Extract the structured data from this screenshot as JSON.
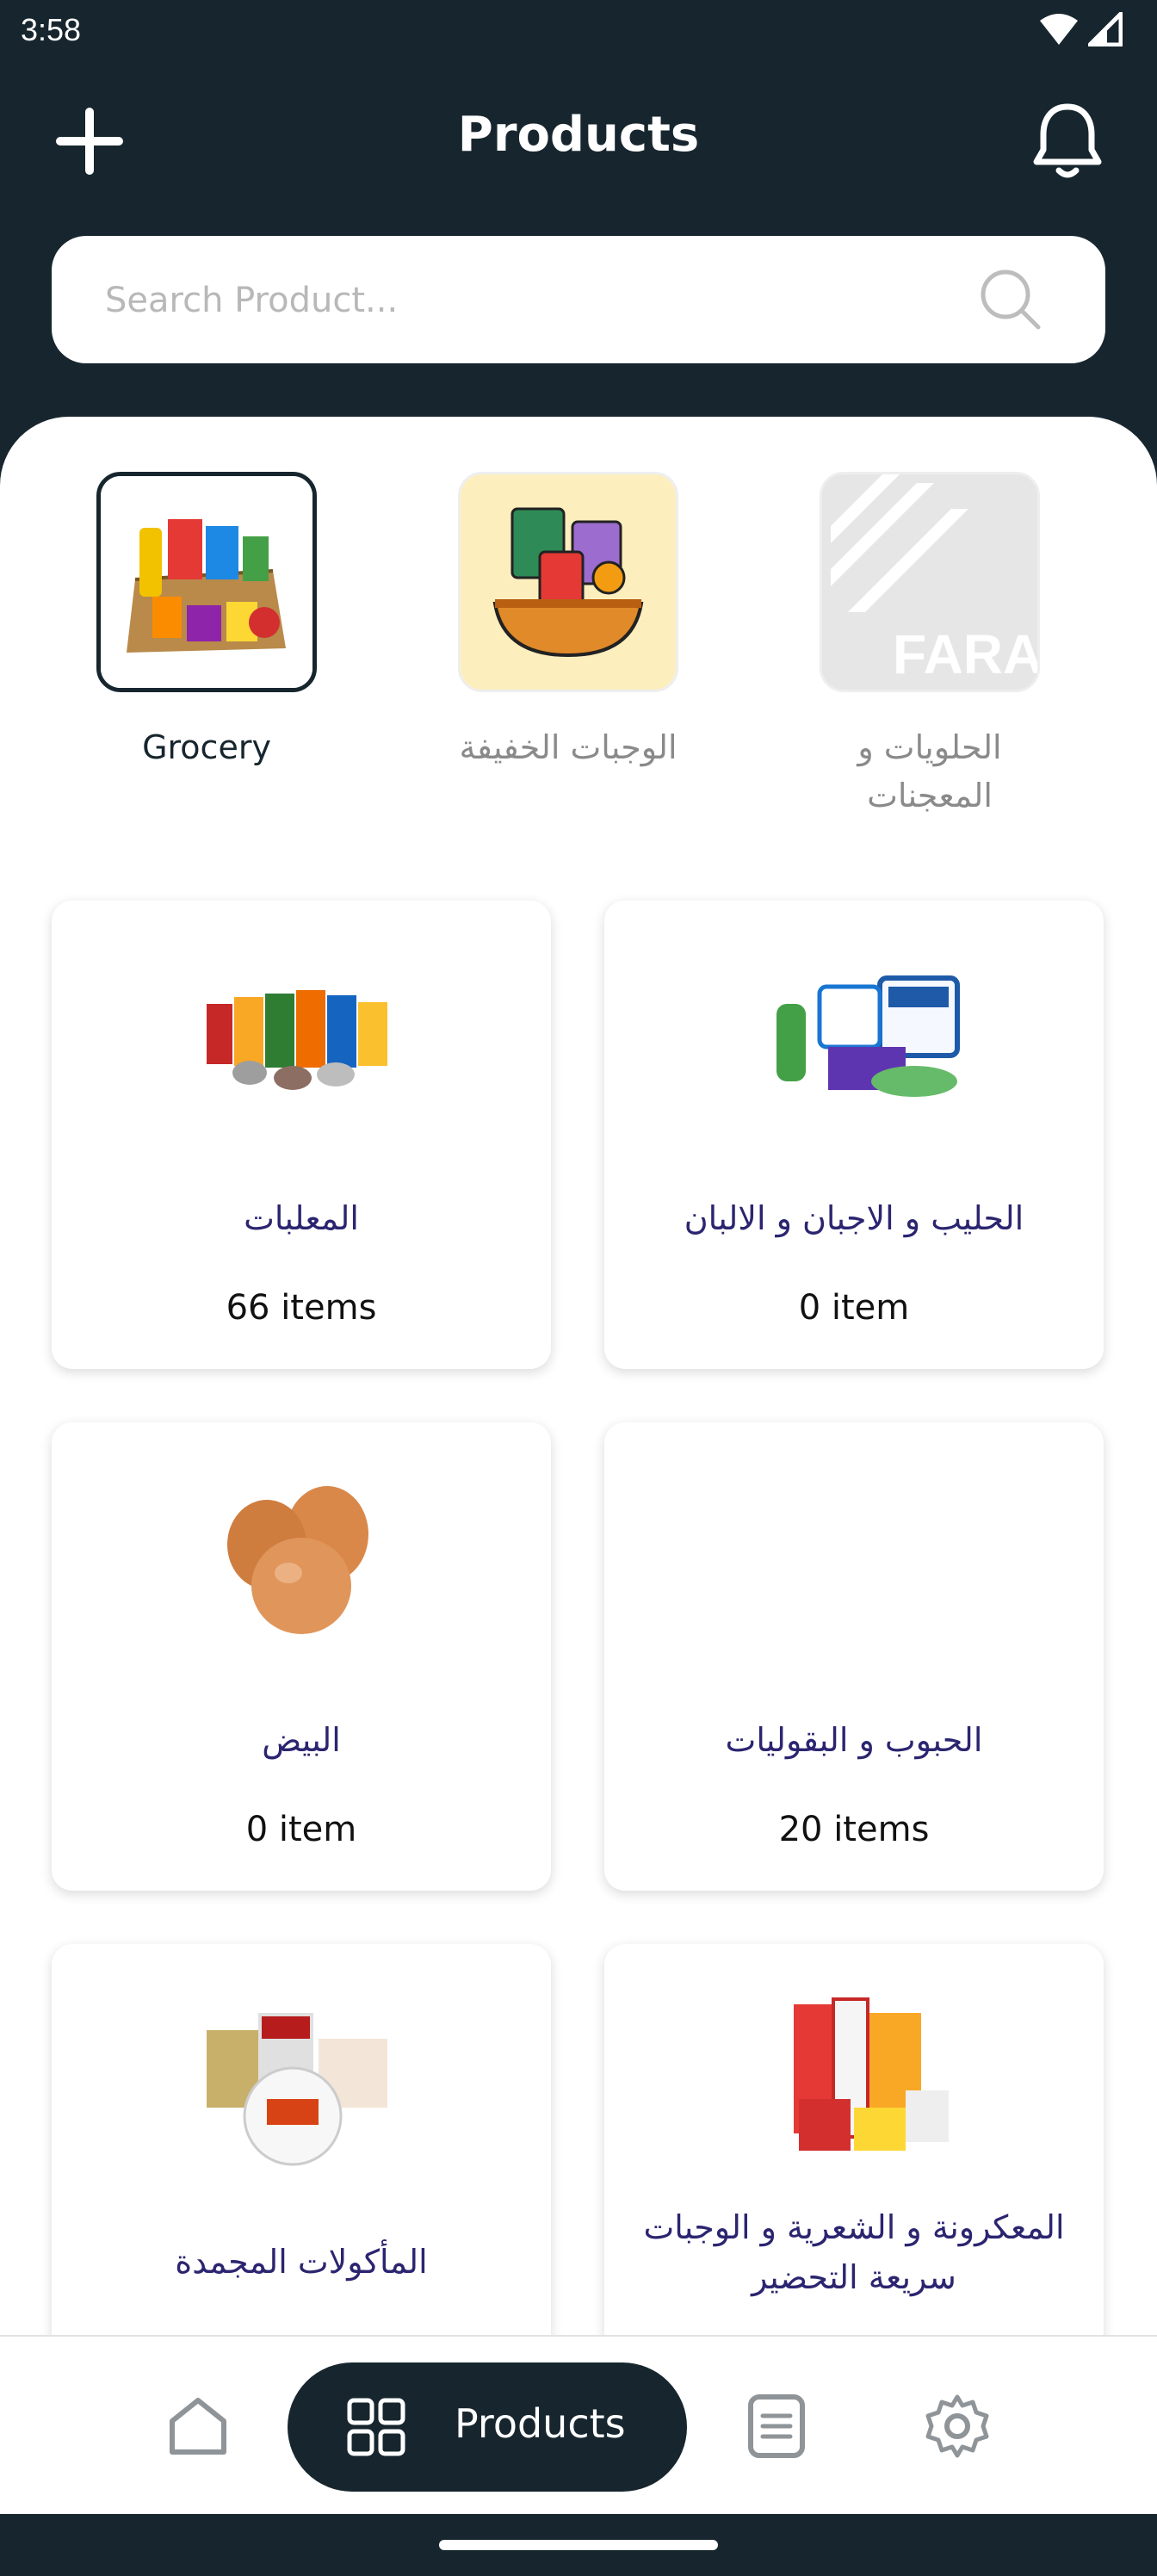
{
  "status": {
    "time": "3:58",
    "icons": [
      "wifi-icon",
      "signal-icon"
    ]
  },
  "header": {
    "title": "Products",
    "add_icon": "plus-icon",
    "notification_icon": "bell-icon"
  },
  "search": {
    "placeholder": "Search Product...",
    "value": "",
    "icon": "search-icon"
  },
  "categories": [
    {
      "label": "Grocery",
      "active": true
    },
    {
      "label": "الوجبات الخفيفة",
      "active": false
    },
    {
      "label": "الحلويات و المعجنات",
      "active": false,
      "thumb_text": "FARA"
    }
  ],
  "products": [
    {
      "name": "المعلبات",
      "count": "66 items"
    },
    {
      "name": "الحليب و الاجبان و الالبان",
      "count": "0 item"
    },
    {
      "name": "البيض",
      "count": "0 item"
    },
    {
      "name": "الحبوب و البقوليات",
      "count": "20 items"
    },
    {
      "name": "المأكولات المجمدة",
      "count": ""
    },
    {
      "name": "المعكرونة و الشعرية و الوجبات سريعة التحضير",
      "count": ""
    }
  ],
  "bottom_nav": {
    "items": [
      {
        "icon": "home-icon"
      },
      {
        "icon": "grid-icon",
        "label": "Products",
        "active": true
      },
      {
        "icon": "document-icon"
      },
      {
        "icon": "gear-icon"
      }
    ]
  },
  "colors": {
    "primary": "#17262e",
    "product_name": "#2b2570",
    "inactive": "#8a8a8a"
  }
}
